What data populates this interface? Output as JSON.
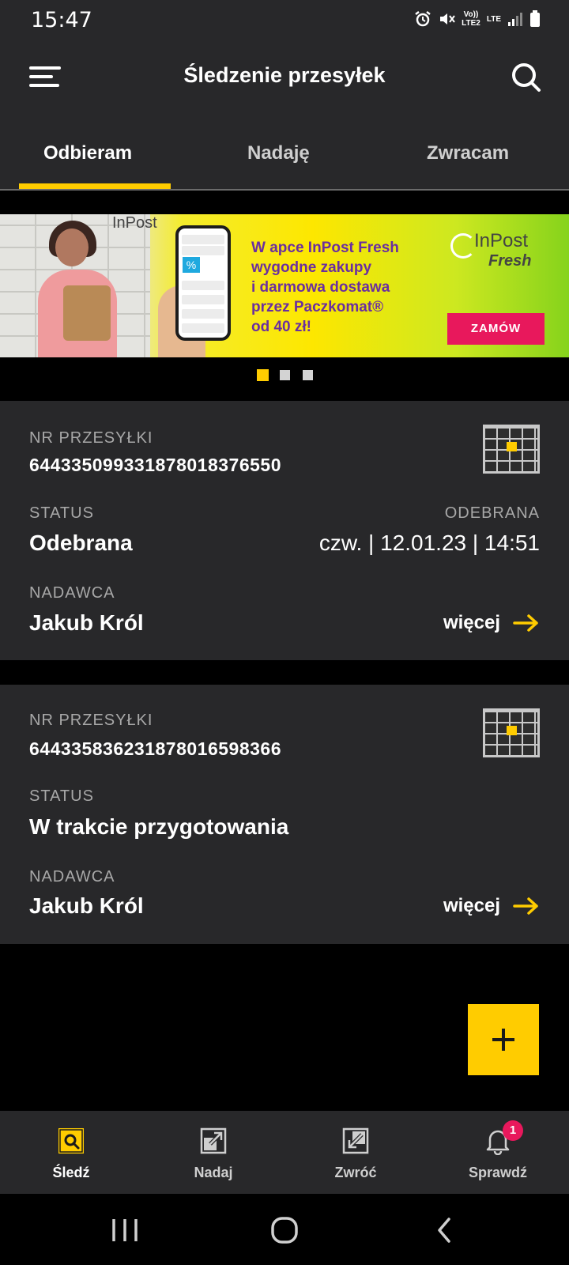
{
  "status_bar": {
    "time": "15:47",
    "icons": [
      "alarm-icon",
      "mute-icon",
      "volte-icon",
      "lte-icon",
      "signal-icon",
      "battery-icon"
    ],
    "volte_label": "Vo))\nLTE2",
    "lte_label": "LTE"
  },
  "app_bar": {
    "title": "Śledzenie przesyłek",
    "menu_icon": "menu-icon",
    "search_icon": "search-icon"
  },
  "tabs": [
    {
      "label": "Odbieram",
      "active": true
    },
    {
      "label": "Nadaję",
      "active": false
    },
    {
      "label": "Zwracam",
      "active": false
    }
  ],
  "banner": {
    "promo_lines": [
      "W apce InPost Fresh",
      "wygodne zakupy",
      "i darmowa dostawa",
      "przez Paczkomat®",
      "od 40 zł!"
    ],
    "brand_small": "InPost",
    "brand_line1": "InPost",
    "brand_line2": "Fresh",
    "cta_label": "ZAMÓW",
    "pager_total": 3,
    "pager_active": 0
  },
  "shipments": [
    {
      "number_label": "NR PRZESYŁKI",
      "number": "644335099331878018376550",
      "status_label": "STATUS",
      "status": "Odebrana",
      "status_right_label": "ODEBRANA",
      "status_date": "czw. | 12.01.23 | 14:51",
      "sender_label": "NADAWCA",
      "sender": "Jakub Król",
      "more_label": "więcej"
    },
    {
      "number_label": "NR PRZESYŁKI",
      "number": "644335836231878016598366",
      "status_label": "STATUS",
      "status": "W trakcie przygotowania",
      "sender_label": "NADAWCA",
      "sender": "Jakub Król",
      "more_label": "więcej"
    }
  ],
  "bottom_nav": [
    {
      "label": "Śledź",
      "icon": "track-icon",
      "active": true
    },
    {
      "label": "Nadaj",
      "icon": "send-icon",
      "active": false
    },
    {
      "label": "Zwróć",
      "icon": "return-icon",
      "active": false
    },
    {
      "label": "Sprawdź",
      "icon": "bell-icon",
      "active": false,
      "badge": "1"
    }
  ],
  "colors": {
    "accent": "#ffcc00",
    "surface": "#28282a",
    "background": "#000000",
    "badge": "#e8185c",
    "promo_text": "#6a2ea0"
  }
}
